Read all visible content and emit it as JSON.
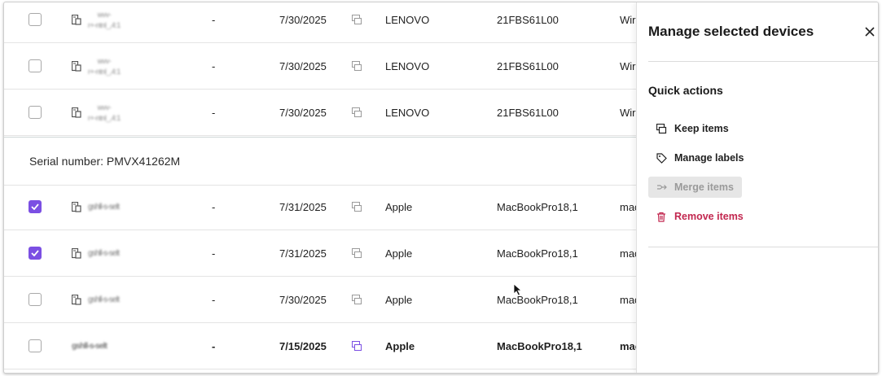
{
  "table": {
    "rows": [
      {
        "id": "r1",
        "checked": false,
        "bold": false,
        "name_line1": "wvv-",
        "name_line2": "r+-ntnl_,4:1",
        "dash": "-",
        "date": "7/30/2025",
        "manufacturer": "LENOVO",
        "model": "21FBS61L00",
        "os": "Wir"
      },
      {
        "id": "r2",
        "checked": false,
        "bold": false,
        "name_line1": "wvv-",
        "name_line2": "r+-ntnl_,4:1",
        "dash": "-",
        "date": "7/30/2025",
        "manufacturer": "LENOVO",
        "model": "21FBS61L00",
        "os": "Wir"
      },
      {
        "id": "r3",
        "checked": false,
        "bold": false,
        "name_line1": "wvv-",
        "name_line2": "r+-ntnl_,4:1",
        "dash": "-",
        "date": "7/30/2025",
        "manufacturer": "LENOVO",
        "model": "21FBS61L00",
        "os": "Wir"
      },
      {
        "id": "r4",
        "checked": true,
        "bold": false,
        "name_line1": "gshll-s-selt",
        "dash": "-",
        "date": "7/31/2025",
        "manufacturer": "Apple",
        "model": "MacBookPro18,1",
        "os": "mac"
      },
      {
        "id": "r5",
        "checked": true,
        "bold": false,
        "name_line1": "gshll-s-selt",
        "dash": "-",
        "date": "7/31/2025",
        "manufacturer": "Apple",
        "model": "MacBookPro18,1",
        "os": "mac"
      },
      {
        "id": "r6",
        "checked": false,
        "bold": false,
        "name_line1": "gshll-s-selt",
        "dash": "-",
        "date": "7/30/2025",
        "manufacturer": "Apple",
        "model": "MacBookPro18,1",
        "os": "mac"
      },
      {
        "id": "r7",
        "checked": false,
        "bold": true,
        "name_line1": "gshll-s-selt",
        "dash": "-",
        "date": "7/15/2025",
        "manufacturer": "Apple",
        "model": "MacBookPro18,1",
        "os": "mac"
      }
    ],
    "group_header": "Serial number: PMVX41262M"
  },
  "panel": {
    "title": "Manage selected devices",
    "section_title": "Quick actions",
    "actions": [
      {
        "label": "Keep items",
        "icon": "keep-icon",
        "disabled": false,
        "danger": false
      },
      {
        "label": "Manage labels",
        "icon": "tag-icon",
        "disabled": false,
        "danger": false
      },
      {
        "label": "Merge items",
        "icon": "merge-arrow-icon",
        "disabled": true,
        "danger": false
      },
      {
        "label": "Remove items",
        "icon": "trash-icon",
        "disabled": false,
        "danger": true
      }
    ]
  },
  "colors": {
    "accent": "#7b4fe3",
    "danger": "#c2274f",
    "disabled_bg": "#e6e6e6"
  }
}
